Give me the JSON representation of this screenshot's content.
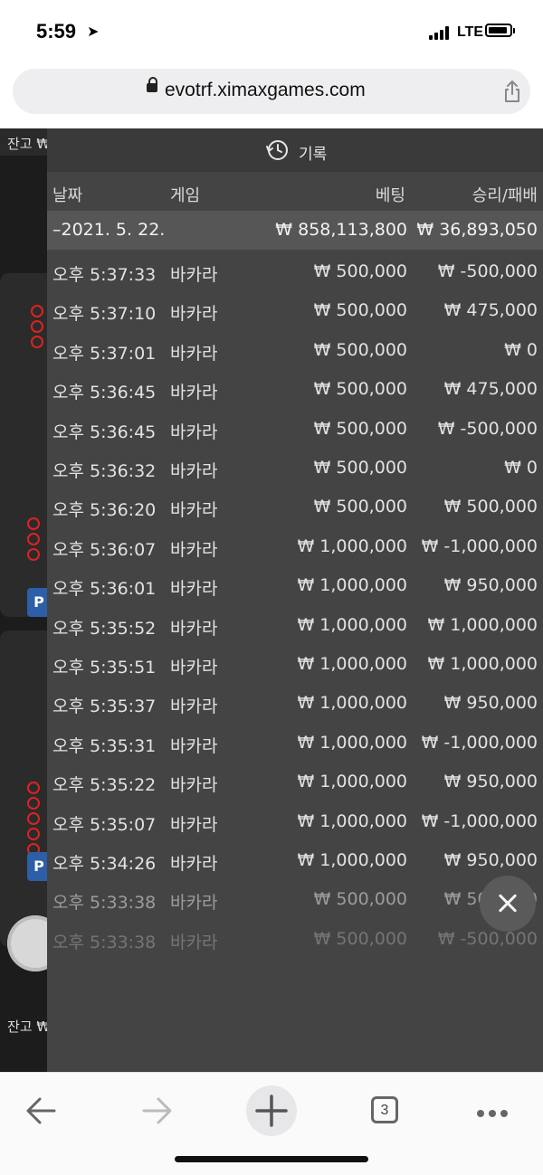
{
  "status_bar": {
    "time": "5:59",
    "network": "LTE"
  },
  "url_bar": {
    "url": "evotrf.ximaxgames.com"
  },
  "background_page": {
    "balance_label_top": "잔고 ₩",
    "balance_label_bottom": "잔고 ₩",
    "p_badge": "P"
  },
  "history": {
    "title": "기록",
    "columns": {
      "date": "날짜",
      "game": "게임",
      "bet": "베팅",
      "win_loss": "승리/패배"
    },
    "date_row": {
      "date": "–2021. 5. 22.",
      "bet": "₩ 858,113,800",
      "win_loss": "₩ 36,893,050"
    },
    "rows": [
      {
        "time": "오후 5:37:33",
        "game": "바카라",
        "bet": "₩ 500,000",
        "win_loss": "₩ -500,000"
      },
      {
        "time": "오후 5:37:10",
        "game": "바카라",
        "bet": "₩ 500,000",
        "win_loss": "₩ 475,000"
      },
      {
        "time": "오후 5:37:01",
        "game": "바카라",
        "bet": "₩ 500,000",
        "win_loss": "₩ 0"
      },
      {
        "time": "오후 5:36:45",
        "game": "바카라",
        "bet": "₩ 500,000",
        "win_loss": "₩ 475,000"
      },
      {
        "time": "오후 5:36:45",
        "game": "바카라",
        "bet": "₩ 500,000",
        "win_loss": "₩ -500,000"
      },
      {
        "time": "오후 5:36:32",
        "game": "바카라",
        "bet": "₩ 500,000",
        "win_loss": "₩ 0"
      },
      {
        "time": "오후 5:36:20",
        "game": "바카라",
        "bet": "₩ 500,000",
        "win_loss": "₩ 500,000"
      },
      {
        "time": "오후 5:36:07",
        "game": "바카라",
        "bet": "₩ 1,000,000",
        "win_loss": "₩ -1,000,000"
      },
      {
        "time": "오후 5:36:01",
        "game": "바카라",
        "bet": "₩ 1,000,000",
        "win_loss": "₩ 950,000"
      },
      {
        "time": "오후 5:35:52",
        "game": "바카라",
        "bet": "₩ 1,000,000",
        "win_loss": "₩ 1,000,000"
      },
      {
        "time": "오후 5:35:51",
        "game": "바카라",
        "bet": "₩ 1,000,000",
        "win_loss": "₩ 1,000,000"
      },
      {
        "time": "오후 5:35:37",
        "game": "바카라",
        "bet": "₩ 1,000,000",
        "win_loss": "₩ 950,000"
      },
      {
        "time": "오후 5:35:31",
        "game": "바카라",
        "bet": "₩ 1,000,000",
        "win_loss": "₩ -1,000,000"
      },
      {
        "time": "오후 5:35:22",
        "game": "바카라",
        "bet": "₩ 1,000,000",
        "win_loss": "₩ 950,000"
      },
      {
        "time": "오후 5:35:07",
        "game": "바카라",
        "bet": "₩ 1,000,000",
        "win_loss": "₩ -1,000,000"
      },
      {
        "time": "오후 5:34:26",
        "game": "바카라",
        "bet": "₩ 1,000,000",
        "win_loss": "₩ 950,000"
      },
      {
        "time": "오후 5:33:38",
        "game": "바카라",
        "bet": "₩ 500,000",
        "win_loss": "₩ 500,000"
      },
      {
        "time": "오후 5:33:38",
        "game": "바카라",
        "bet": "₩ 500,000",
        "win_loss": "₩ -500,000"
      }
    ]
  },
  "toolbar": {
    "tab_count": "3"
  },
  "icons": {
    "status": [
      "location-arrow-icon",
      "signal-icon",
      "battery-icon"
    ],
    "url": [
      "lock-icon",
      "share-icon"
    ],
    "panel": [
      "clock-history-icon",
      "close-icon"
    ],
    "toolbar": [
      "back-arrow-icon",
      "forward-arrow-icon",
      "new-tab-plus-icon",
      "tabs-icon",
      "more-dots-icon"
    ]
  }
}
